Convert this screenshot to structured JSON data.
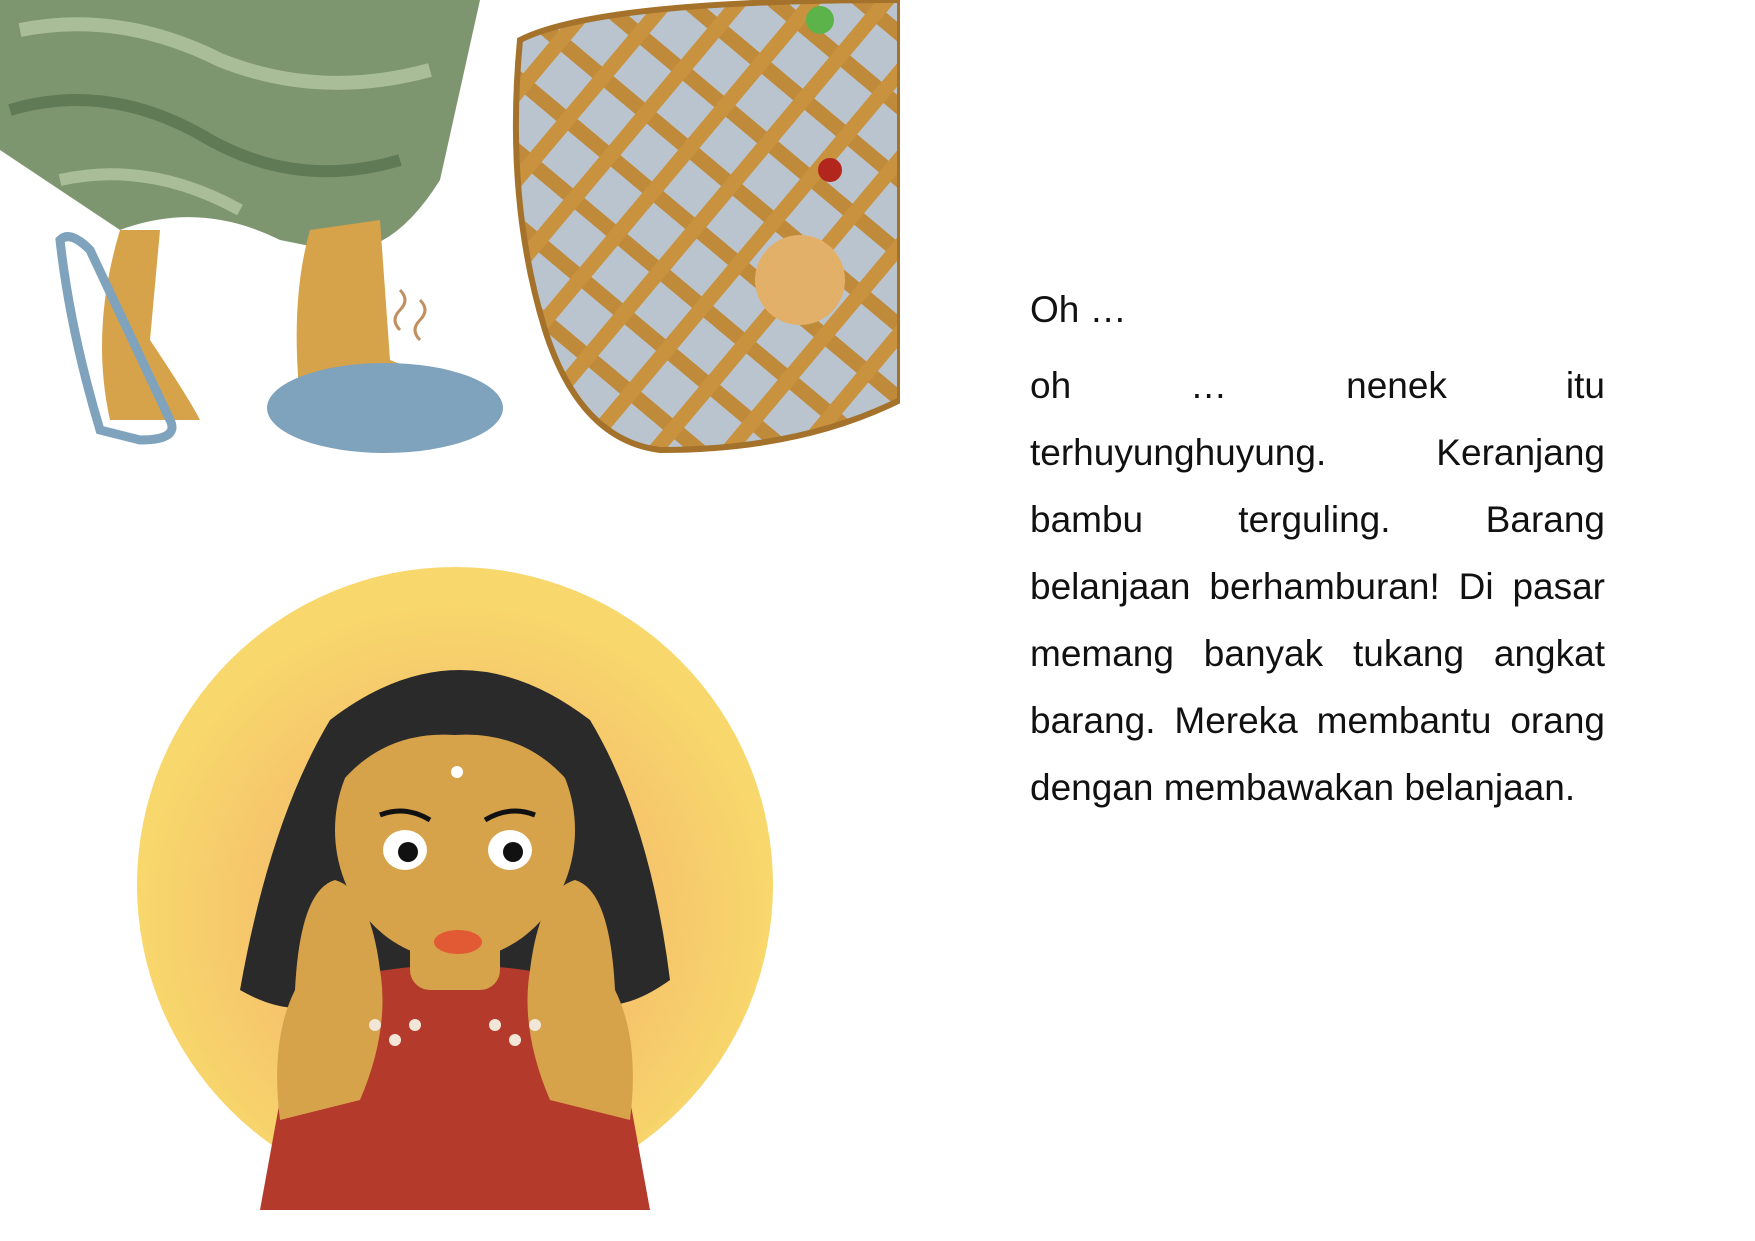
{
  "story": {
    "exclaim": "Oh …",
    "line_oh": "oh … nenek itu",
    "paragraph": "terhuyunghuyung. Keranjang bambu terguling. Barang belanjaan berhamburan! Di pasar memang banyak tukang angkat barang. Mereka membantu orang dengan membawakan belanjaan."
  },
  "colors": {
    "skirt": "#7e9670",
    "skin": "#d6a24a",
    "sandal": "#7fa3bd",
    "basket": "#c08a3b",
    "halo_outer": "#f8d86c",
    "halo_inner": "#f0a45a",
    "hair": "#2a2a2a",
    "dress": "#b43a2c"
  }
}
